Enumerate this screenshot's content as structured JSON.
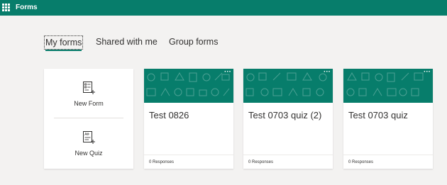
{
  "app": {
    "title": "Forms"
  },
  "tabs": [
    {
      "label": "My forms",
      "active": true
    },
    {
      "label": "Shared with me",
      "active": false
    },
    {
      "label": "Group forms",
      "active": false
    }
  ],
  "new_actions": {
    "new_form": {
      "label": "New Form",
      "icon": "new-form-icon"
    },
    "new_quiz": {
      "label": "New Quiz",
      "icon": "new-quiz-icon"
    }
  },
  "forms": [
    {
      "title": "Test 0826",
      "responses": "0 Responses"
    },
    {
      "title": "Test 0703 quiz (2)",
      "responses": "0 Responses"
    },
    {
      "title": "Test 0703 quiz",
      "responses": "0 Responses"
    }
  ],
  "card_more": "···",
  "colors": {
    "brand": "#077d6b",
    "background": "#f3f2f1",
    "card": "#ffffff"
  }
}
